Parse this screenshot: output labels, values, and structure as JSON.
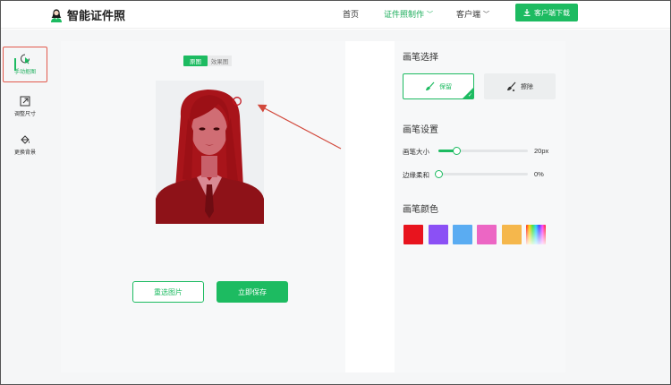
{
  "header": {
    "logo_text": "智能证件照",
    "nav": [
      {
        "label": "首页",
        "active": false,
        "dropdown": false
      },
      {
        "label": "证件照制作",
        "active": true,
        "dropdown": true
      },
      {
        "label": "客户端",
        "active": false,
        "dropdown": true
      }
    ],
    "download_label": "客户端下载"
  },
  "editor": {
    "tabs": [
      {
        "label": "原图",
        "active": true
      },
      {
        "label": "效果图",
        "active": false
      }
    ],
    "reselect_label": "重选图片",
    "save_label": "立即保存"
  },
  "tools": [
    {
      "label": "手动抠图",
      "icon": "hand-cutout-icon",
      "active": true
    },
    {
      "label": "调整尺寸",
      "icon": "resize-icon",
      "active": false
    },
    {
      "label": "更换背景",
      "icon": "paint-bucket-icon",
      "active": false
    }
  ],
  "brush": {
    "select_title": "画笔选择",
    "keep_label": "保留",
    "erase_label": "擦除",
    "settings_title": "画笔设置",
    "size_label": "画笔大小",
    "size_value": "20px",
    "size_fraction": 0.2,
    "soft_label": "边缘柔和",
    "soft_value": "0%",
    "soft_fraction": 0,
    "color_title": "画笔颜色",
    "colors": [
      "#e8141e",
      "#8b50f5",
      "#5aacf2",
      "#ec66c4",
      "#f5b74c",
      "rainbow"
    ]
  },
  "colors": {
    "accent": "#1dbb61",
    "highlight_border": "#e25a4d",
    "mask_red": "#c0141c"
  }
}
